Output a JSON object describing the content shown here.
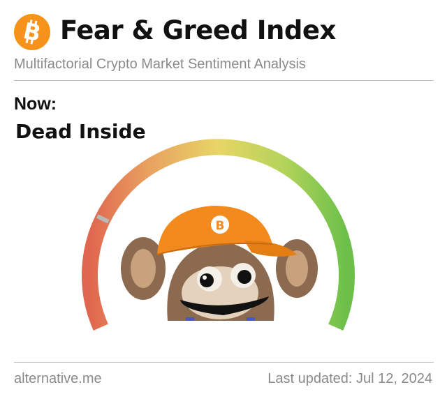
{
  "header": {
    "title": "Fear & Greed Index",
    "subtitle": "Multifactorial Crypto Market Sentiment Analysis",
    "logo_icon": "bitcoin-icon"
  },
  "current": {
    "label": "Now:",
    "status": "Dead Inside"
  },
  "gauge": {
    "needle_fraction": 0.22,
    "colors": {
      "fear": "#e0674f",
      "neutral": "#e8d566",
      "greed": "#6cc04a"
    },
    "mascot_icon": "monkey-bitcoin-cap-icon"
  },
  "footer": {
    "source": "alternative.me",
    "updated": "Last updated: Jul 12, 2024"
  },
  "colors": {
    "bitcoin_orange": "#f7931a",
    "text_primary": "#111111",
    "text_muted": "#8a8a8a"
  }
}
